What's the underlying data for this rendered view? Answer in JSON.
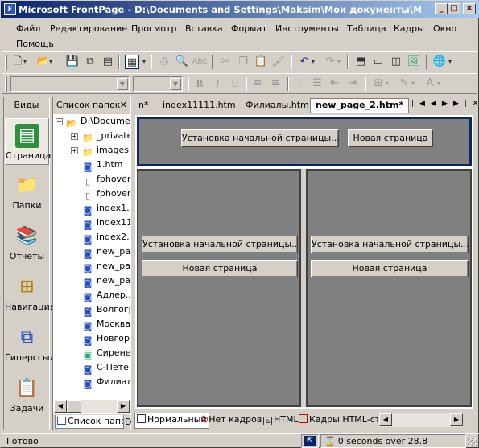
{
  "window": {
    "title": "Microsoft FrontPage - D:\\Documents and Settings\\Maksim\\Мои документы\\Мои Web\\n...",
    "app_icon": "frontpage-icon",
    "buttons": [
      "_",
      "□",
      "×"
    ]
  },
  "menu": [
    "Файл",
    "Редактирование",
    "Просмотр",
    "Вставка",
    "Формат",
    "Инструменты",
    "Таблица",
    "Кадры",
    "Окно",
    "Помощь"
  ],
  "views": {
    "header": "Виды",
    "items": [
      {
        "label": "Страница",
        "icon": "page-view-icon",
        "selected": true
      },
      {
        "label": "Папки",
        "icon": "folders-icon",
        "selected": false
      },
      {
        "label": "Отчеты",
        "icon": "reports-icon",
        "selected": false
      },
      {
        "label": "Навигация",
        "icon": "navigation-icon",
        "selected": false
      },
      {
        "label": "Гиперссылки",
        "icon": "hyperlinks-icon",
        "selected": false
      },
      {
        "label": "Задачи",
        "icon": "tasks-icon",
        "selected": false
      }
    ]
  },
  "folder_list": {
    "header": "Список папок",
    "close": "✕",
    "root": "D:\\Documents...",
    "items": [
      {
        "name": "_private",
        "type": "folder",
        "expandable": true
      },
      {
        "name": "images",
        "type": "folder",
        "expandable": true
      },
      {
        "name": "1.htm",
        "type": "page"
      },
      {
        "name": "fphover...",
        "type": "file"
      },
      {
        "name": "fphover...",
        "type": "file"
      },
      {
        "name": "index1...",
        "type": "page"
      },
      {
        "name": "index11...",
        "type": "page"
      },
      {
        "name": "index2...",
        "type": "page"
      },
      {
        "name": "new_pa...",
        "type": "page"
      },
      {
        "name": "new_pa...",
        "type": "page"
      },
      {
        "name": "new_pa...",
        "type": "page"
      },
      {
        "name": "Адлер...",
        "type": "page"
      },
      {
        "name": "Волгогр...",
        "type": "page"
      },
      {
        "name": "Москва...",
        "type": "page"
      },
      {
        "name": "Новгор...",
        "type": "page"
      },
      {
        "name": "Сирене...",
        "type": "image"
      },
      {
        "name": "С-Пете...",
        "type": "page"
      },
      {
        "name": "Филиал...",
        "type": "page"
      }
    ],
    "bottom_tab": "Список папок",
    "bottom_tab2": "D"
  },
  "doc_tabs": [
    {
      "label": "n*",
      "active": false
    },
    {
      "label": "index11111.htm",
      "active": false
    },
    {
      "label": "Филиалы.htm",
      "active": false
    },
    {
      "label": "new_page_2.htm*",
      "active": true
    }
  ],
  "tab_nav": [
    "|◀",
    "◀",
    "▶",
    "▶|",
    "✕"
  ],
  "frames": {
    "top": {
      "set_home": "Установка начальной страницы...",
      "new_page": "Новая страница"
    },
    "left": {
      "set_home": "Установка начальной страницы...",
      "new_page": "Новая страница"
    },
    "right": {
      "set_home": "Установка начальной страницы...",
      "new_page": "Новая страница"
    }
  },
  "view_tabs": [
    "Нормальный",
    "Нет кадров",
    "HTML",
    "Кадры HTML-стр"
  ],
  "status": {
    "ready": "Готово",
    "timing": "0 seconds over 28.8"
  }
}
